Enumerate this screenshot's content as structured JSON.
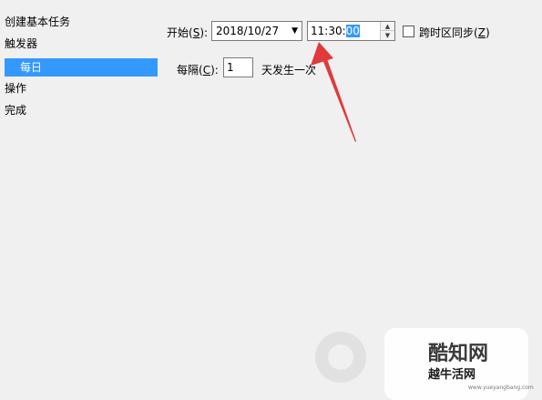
{
  "sidebar": {
    "items": [
      {
        "label": "创建基本任务"
      },
      {
        "label": "触发器"
      },
      {
        "label": "每日"
      },
      {
        "label": "操作"
      },
      {
        "label": "完成"
      }
    ]
  },
  "start": {
    "label": "开始",
    "mnemonic": "S",
    "date_value": "2018/10/27",
    "time_prefix": "11:30:",
    "time_selected": "00"
  },
  "sync": {
    "label": "跨时区同步",
    "mnemonic": "Z",
    "checked": false
  },
  "recur": {
    "label": "每隔",
    "mnemonic": "C",
    "value": "1",
    "suffix": "天发生一次"
  },
  "icons": {
    "dropdown": "chevron-down-icon",
    "spinner_up": "caret-up-icon",
    "spinner_down": "caret-down-icon"
  },
  "colors": {
    "background": "#f0f0f0",
    "selection": "#3399ff",
    "annotation_arrow": "#e03a3a"
  },
  "watermark": {
    "text_line1": "酷知网",
    "text_line2": "越牛活网",
    "url": "www.yueyangbang.com"
  }
}
